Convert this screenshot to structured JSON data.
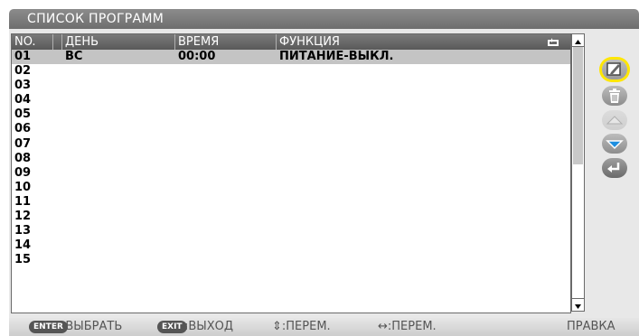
{
  "title": "СПИСОК ПРОГРАММ",
  "table": {
    "columns": [
      "NO.",
      "ДЕНЬ",
      "ВРЕМЯ",
      "ФУНКЦИЯ"
    ],
    "rows": [
      {
        "no": "01",
        "day": "ВС",
        "time": "00:00",
        "function": "ПИТАНИЕ-ВЫКЛ.",
        "selected": true
      },
      {
        "no": "02",
        "day": "",
        "time": "",
        "function": ""
      },
      {
        "no": "03",
        "day": "",
        "time": "",
        "function": ""
      },
      {
        "no": "04",
        "day": "",
        "time": "",
        "function": ""
      },
      {
        "no": "05",
        "day": "",
        "time": "",
        "function": ""
      },
      {
        "no": "06",
        "day": "",
        "time": "",
        "function": ""
      },
      {
        "no": "07",
        "day": "",
        "time": "",
        "function": ""
      },
      {
        "no": "08",
        "day": "",
        "time": "",
        "function": ""
      },
      {
        "no": "09",
        "day": "",
        "time": "",
        "function": ""
      },
      {
        "no": "10",
        "day": "",
        "time": "",
        "function": ""
      },
      {
        "no": "11",
        "day": "",
        "time": "",
        "function": ""
      },
      {
        "no": "12",
        "day": "",
        "time": "",
        "function": ""
      },
      {
        "no": "13",
        "day": "",
        "time": "",
        "function": ""
      },
      {
        "no": "14",
        "day": "",
        "time": "",
        "function": ""
      },
      {
        "no": "15",
        "day": "",
        "time": "",
        "function": ""
      }
    ]
  },
  "icons": {
    "repeat": "repeat-icon",
    "edit": "edit-icon",
    "delete": "trash-icon",
    "up": "triangle-up-icon",
    "down": "triangle-down-icon",
    "back": "return-icon"
  },
  "footer": {
    "enter_key": "ENTER",
    "enter_label": ":ВЫБРАТЬ",
    "exit_key": "EXIT",
    "exit_label": ":ВЫХОД",
    "updown_label": "⇕:ПЕРЕМ.",
    "leftright_label": "↔:ПЕРЕМ.",
    "right_label": "ПРАВКА"
  },
  "colors": {
    "highlight": "#ffe600",
    "accent_blue": "#1e8fe0"
  }
}
